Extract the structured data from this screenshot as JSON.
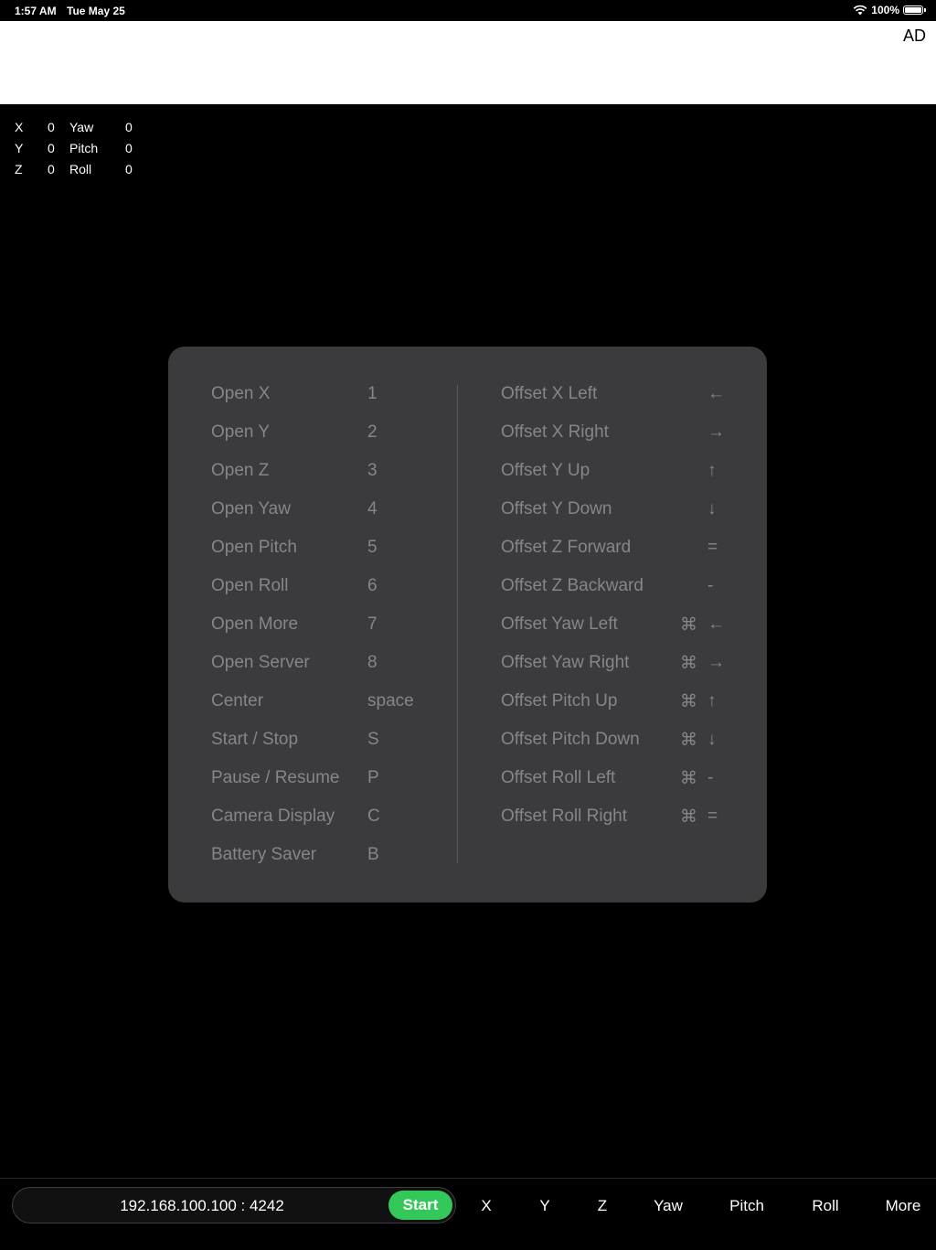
{
  "status_bar": {
    "time": "1:57 AM",
    "date": "Tue May 25",
    "battery": "100%"
  },
  "ad": {
    "label": "AD"
  },
  "readout": {
    "rows": [
      {
        "axis": "X",
        "axis_value": "0",
        "rotation": "Yaw",
        "rotation_value": "0"
      },
      {
        "axis": "Y",
        "axis_value": "0",
        "rotation": "Pitch",
        "rotation_value": "0"
      },
      {
        "axis": "Z",
        "axis_value": "0",
        "rotation": "Roll",
        "rotation_value": "0"
      }
    ]
  },
  "shortcuts": {
    "left": [
      {
        "label": "Open X",
        "key": "1"
      },
      {
        "label": "Open Y",
        "key": "2"
      },
      {
        "label": "Open Z",
        "key": "3"
      },
      {
        "label": "Open Yaw",
        "key": "4"
      },
      {
        "label": "Open Pitch",
        "key": "5"
      },
      {
        "label": "Open Roll",
        "key": "6"
      },
      {
        "label": "Open More",
        "key": "7"
      },
      {
        "label": "Open Server",
        "key": "8"
      },
      {
        "label": "Center",
        "key": "space"
      },
      {
        "label": "Start / Stop",
        "key": "S"
      },
      {
        "label": "Pause / Resume",
        "key": "P"
      },
      {
        "label": "Camera Display",
        "key": "C"
      },
      {
        "label": "Battery Saver",
        "key": "B"
      }
    ],
    "right": [
      {
        "label": "Offset X Left",
        "modifier": "",
        "key": "←"
      },
      {
        "label": "Offset X Right",
        "modifier": "",
        "key": "→"
      },
      {
        "label": "Offset Y Up",
        "modifier": "",
        "key": "↑"
      },
      {
        "label": "Offset Y Down",
        "modifier": "",
        "key": "↓"
      },
      {
        "label": "Offset Z Forward",
        "modifier": "",
        "key": "="
      },
      {
        "label": "Offset Z Backward",
        "modifier": "",
        "key": "-"
      },
      {
        "label": "Offset Yaw Left",
        "modifier": "⌘",
        "key": "←"
      },
      {
        "label": "Offset Yaw Right",
        "modifier": "⌘",
        "key": "→"
      },
      {
        "label": "Offset Pitch Up",
        "modifier": "⌘",
        "key": "↑"
      },
      {
        "label": "Offset Pitch Down",
        "modifier": "⌘",
        "key": "↓"
      },
      {
        "label": "Offset Roll Left",
        "modifier": "⌘",
        "key": "-"
      },
      {
        "label": "Offset Roll Right",
        "modifier": "⌘",
        "key": "="
      }
    ]
  },
  "toolbar": {
    "server_address": "192.168.100.100 : 4242",
    "start_label": "Start",
    "tabs": [
      "X",
      "Y",
      "Z",
      "Yaw",
      "Pitch",
      "Roll",
      "More"
    ]
  },
  "colors": {
    "start_button": "#34c759",
    "panel": "#3b3b3d",
    "panel_text": "#868688"
  }
}
